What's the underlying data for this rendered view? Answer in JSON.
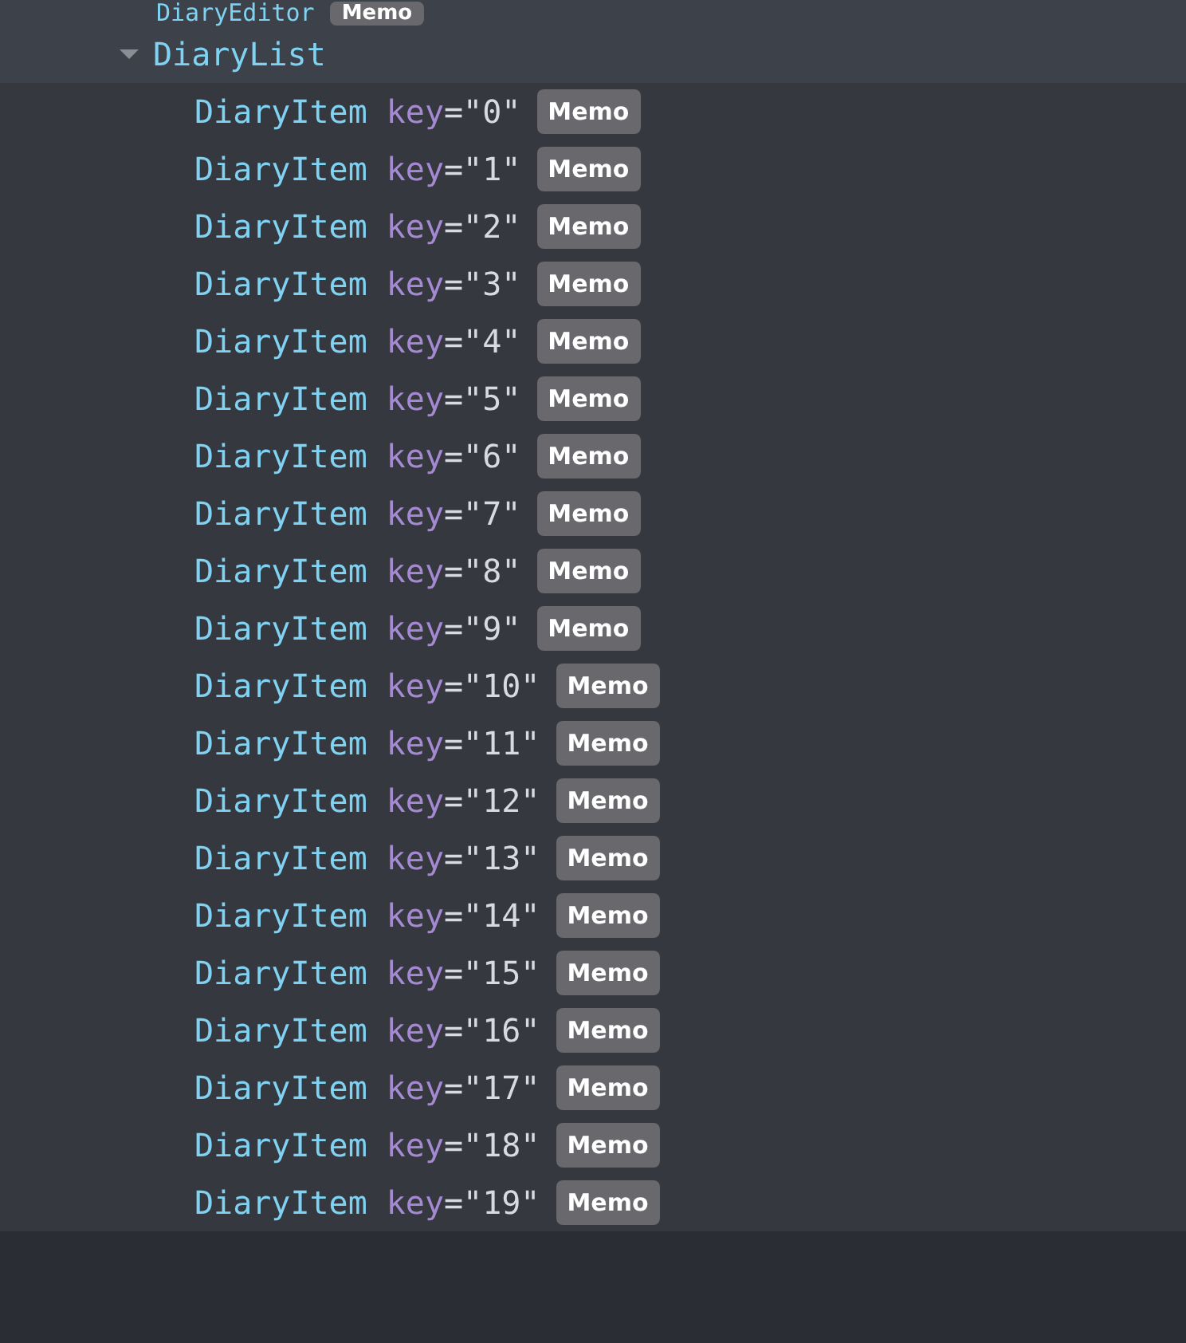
{
  "tree": {
    "above": {
      "name": "DiaryEditor",
      "badge": "Memo"
    },
    "node": {
      "name": "DiaryList",
      "expanded": true,
      "children": [
        {
          "name": "DiaryItem",
          "attr": "key",
          "value": "=\"0\"",
          "badge": "Memo"
        },
        {
          "name": "DiaryItem",
          "attr": "key",
          "value": "=\"1\"",
          "badge": "Memo"
        },
        {
          "name": "DiaryItem",
          "attr": "key",
          "value": "=\"2\"",
          "badge": "Memo"
        },
        {
          "name": "DiaryItem",
          "attr": "key",
          "value": "=\"3\"",
          "badge": "Memo"
        },
        {
          "name": "DiaryItem",
          "attr": "key",
          "value": "=\"4\"",
          "badge": "Memo"
        },
        {
          "name": "DiaryItem",
          "attr": "key",
          "value": "=\"5\"",
          "badge": "Memo"
        },
        {
          "name": "DiaryItem",
          "attr": "key",
          "value": "=\"6\"",
          "badge": "Memo"
        },
        {
          "name": "DiaryItem",
          "attr": "key",
          "value": "=\"7\"",
          "badge": "Memo"
        },
        {
          "name": "DiaryItem",
          "attr": "key",
          "value": "=\"8\"",
          "badge": "Memo"
        },
        {
          "name": "DiaryItem",
          "attr": "key",
          "value": "=\"9\"",
          "badge": "Memo"
        },
        {
          "name": "DiaryItem",
          "attr": "key",
          "value": "=\"10\"",
          "badge": "Memo"
        },
        {
          "name": "DiaryItem",
          "attr": "key",
          "value": "=\"11\"",
          "badge": "Memo"
        },
        {
          "name": "DiaryItem",
          "attr": "key",
          "value": "=\"12\"",
          "badge": "Memo"
        },
        {
          "name": "DiaryItem",
          "attr": "key",
          "value": "=\"13\"",
          "badge": "Memo"
        },
        {
          "name": "DiaryItem",
          "attr": "key",
          "value": "=\"14\"",
          "badge": "Memo"
        },
        {
          "name": "DiaryItem",
          "attr": "key",
          "value": "=\"15\"",
          "badge": "Memo"
        },
        {
          "name": "DiaryItem",
          "attr": "key",
          "value": "=\"16\"",
          "badge": "Memo"
        },
        {
          "name": "DiaryItem",
          "attr": "key",
          "value": "=\"17\"",
          "badge": "Memo"
        },
        {
          "name": "DiaryItem",
          "attr": "key",
          "value": "=\"18\"",
          "badge": "Memo"
        },
        {
          "name": "DiaryItem",
          "attr": "key",
          "value": "=\"19\"",
          "badge": "Memo"
        }
      ]
    }
  }
}
